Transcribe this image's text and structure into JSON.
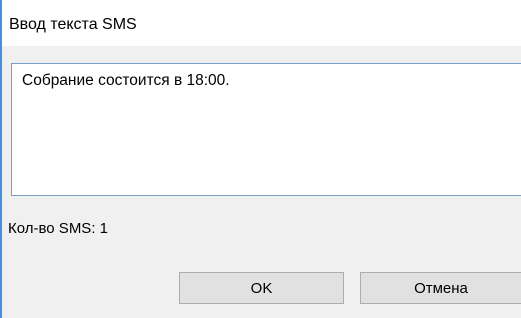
{
  "window": {
    "title": "Ввод текста SMS"
  },
  "message": {
    "text": "Собрание состоится в 18:00."
  },
  "status": {
    "sms_count_label": "Кол-во SMS: 1"
  },
  "buttons": {
    "ok_label": "OK",
    "cancel_label": "Отмена"
  },
  "colors": {
    "accent": "#4a90d9",
    "textbox_border": "#7a9ec6",
    "dialog_background": "#f0f0f0",
    "button_face": "#e1e1e1"
  }
}
